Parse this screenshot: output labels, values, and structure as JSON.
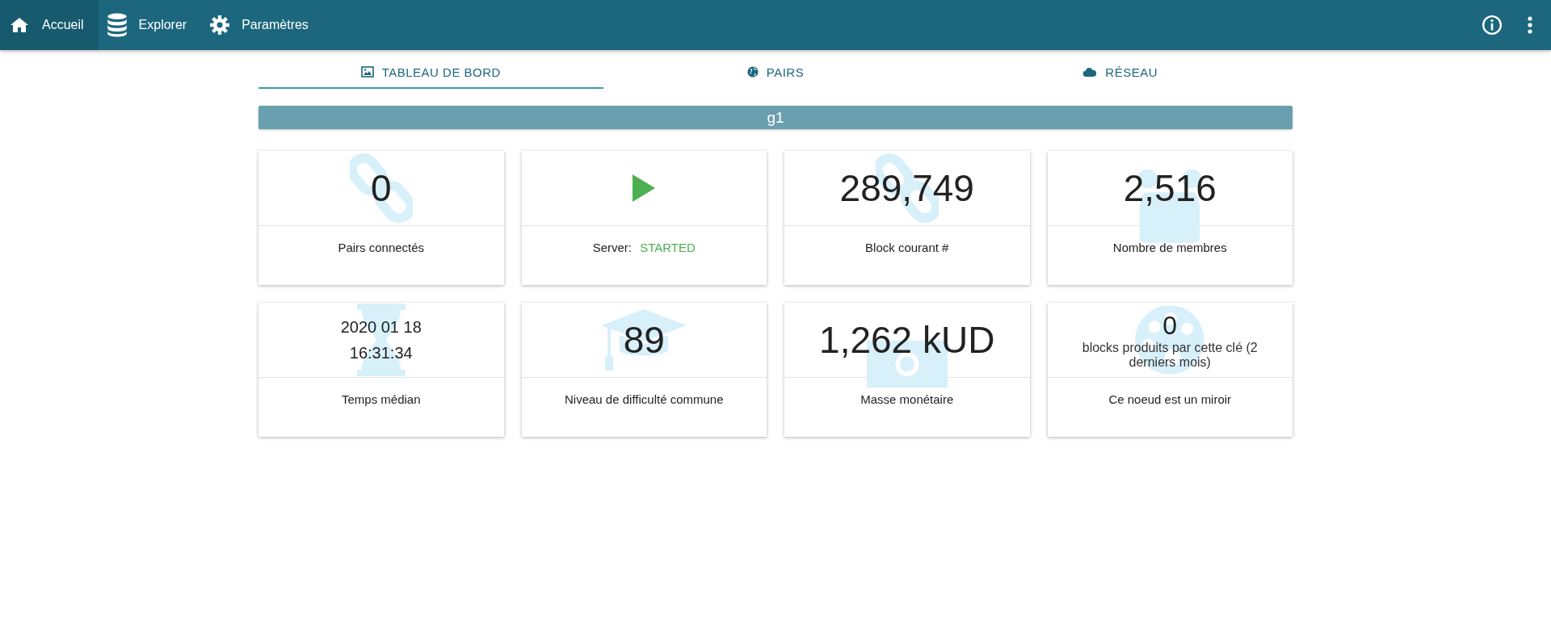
{
  "nav": [
    {
      "label": "Accueil",
      "selected": true
    },
    {
      "label": "Explorer",
      "selected": false
    },
    {
      "label": "Paramètres",
      "selected": false
    }
  ],
  "tabs": [
    {
      "label": "TABLEAU DE BORD",
      "selected": true
    },
    {
      "label": "PAIRS",
      "selected": false
    },
    {
      "label": "RÉSEAU",
      "selected": false
    }
  ],
  "currency": "g1",
  "cards": [
    {
      "kind": "value",
      "value": "0",
      "label": "Pairs connectés"
    },
    {
      "kind": "status",
      "status_label": "Server:",
      "status": "STARTED"
    },
    {
      "kind": "value",
      "value": "289,749",
      "label": "Block courant #"
    },
    {
      "kind": "value",
      "value": "2,516",
      "label": "Nombre de membres"
    },
    {
      "kind": "datetime",
      "lines": [
        "2020 01 18",
        "16:31:34"
      ],
      "label": "Temps médian"
    },
    {
      "kind": "value",
      "value": "89",
      "label": "Niveau de difficulté commune"
    },
    {
      "kind": "value",
      "value": "1,262 kUD",
      "label": "Masse monétaire"
    },
    {
      "kind": "caption",
      "value": "0",
      "caption": "blocks produits par cette clé (2 derniers mois)",
      "label": "Ce noeud est un miroir"
    }
  ]
}
